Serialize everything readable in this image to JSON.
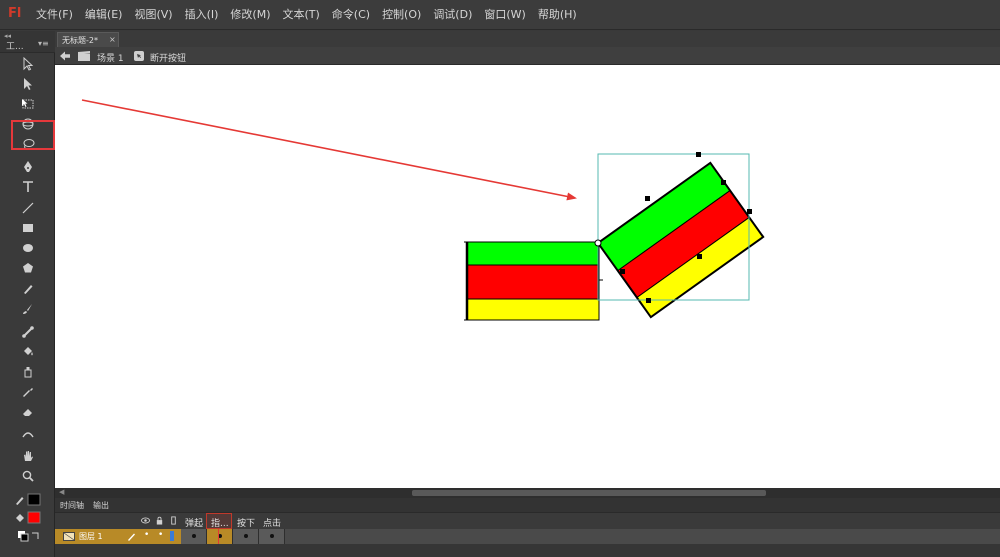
{
  "app": {
    "logo": "Fl"
  },
  "menu": [
    "文件(F)",
    "编辑(E)",
    "视图(V)",
    "插入(I)",
    "修改(M)",
    "文本(T)",
    "命令(C)",
    "控制(O)",
    "调试(D)",
    "窗口(W)",
    "帮助(H)"
  ],
  "toolbox": {
    "title": "工...",
    "tools": [
      "selection-tool",
      "subselection-tool",
      "free-transform-tool",
      "3d-rotation-tool",
      "lasso-tool",
      "pen-tool",
      "text-tool",
      "line-tool",
      "rectangle-tool",
      "oval-tool",
      "polystar-tool",
      "pencil-tool",
      "brush-tool",
      "bone-tool",
      "paint-bucket-tool",
      "ink-bottle-tool",
      "eyedropper-tool",
      "eraser-tool",
      "width-tool",
      "hand-tool",
      "zoom-tool"
    ],
    "highlighted_tool": "free-transform-tool",
    "stroke_color": "#000000",
    "fill_color": "#ff0000"
  },
  "document": {
    "tab_label": "无标题-2*",
    "scene_label": "场景 1",
    "symbol_label": "断开按钮"
  },
  "stage": {
    "stripe_colors": [
      "#00ff00",
      "#ff0000",
      "#ffff00"
    ],
    "bbox_color": "#54b8b0",
    "arrow_color": "#e53935"
  },
  "timeline": {
    "tabs": [
      "时间轴",
      "输出"
    ],
    "frame_labels": [
      "弹起",
      "指...",
      "按下",
      "点击"
    ],
    "layer_name": "图层 1",
    "layer_color": "#b88a27"
  }
}
